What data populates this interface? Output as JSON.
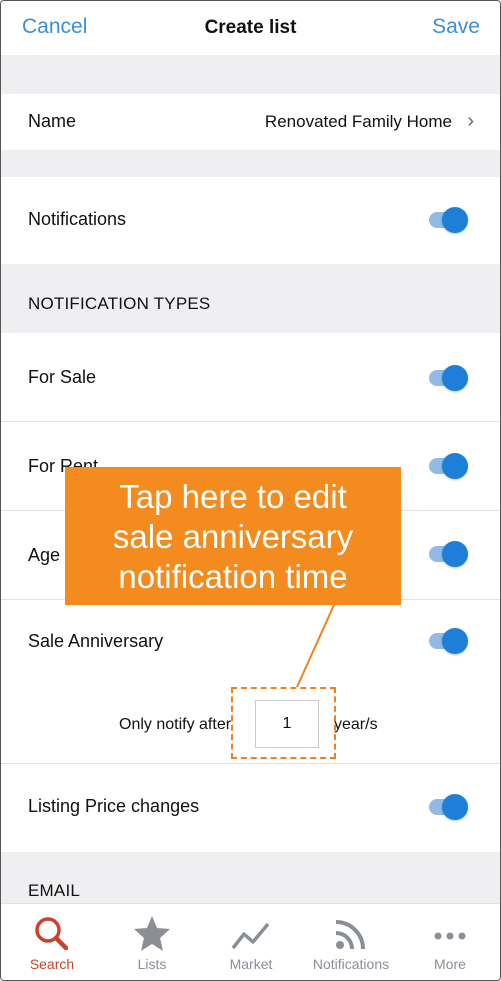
{
  "header": {
    "cancel_label": "Cancel",
    "title": "Create list",
    "save_label": "Save"
  },
  "name_row": {
    "label": "Name",
    "value": "Renovated Family Home"
  },
  "notifications_row": {
    "label": "Notifications",
    "enabled": true
  },
  "notification_types": {
    "heading": "NOTIFICATION TYPES",
    "items": [
      {
        "label": "For Sale",
        "enabled": true
      },
      {
        "label": "For Rent",
        "enabled": true
      },
      {
        "label": "Age",
        "enabled": true
      },
      {
        "label": "Sale Anniversary",
        "enabled": true
      },
      {
        "label": "Listing Price changes",
        "enabled": true
      }
    ],
    "anniversary": {
      "prefix": "Only notify after",
      "value": "1",
      "suffix": "year/s"
    }
  },
  "email_section": {
    "heading": "EMAIL"
  },
  "callout": {
    "line1": "Tap here to edit",
    "line2": "sale anniversary",
    "line3": "notification time"
  },
  "tabbar": {
    "tabs": [
      {
        "label": "Search",
        "icon": "search-icon",
        "active": true
      },
      {
        "label": "Lists",
        "icon": "star-icon",
        "active": false
      },
      {
        "label": "Market",
        "icon": "trend-line-icon",
        "active": false
      },
      {
        "label": "Notifications",
        "icon": "rss-icon",
        "active": false
      },
      {
        "label": "More",
        "icon": "more-dots-icon",
        "active": false
      }
    ]
  },
  "colors": {
    "accent": "#3c8fd6",
    "toggle_on": "#1e7fd9",
    "callout": "#f38b1e",
    "active_tab": "#c9432b"
  }
}
